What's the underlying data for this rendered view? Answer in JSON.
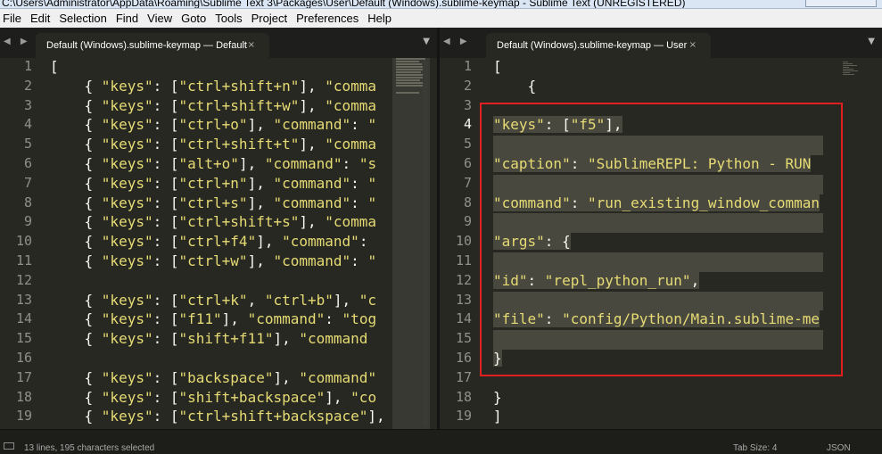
{
  "window": {
    "title": "C:\\Users\\Administrator\\AppData\\Roaming\\Sublime Text 3\\Packages\\User\\Default (Windows).sublime-keymap - Sublime Text (UNREGISTERED)"
  },
  "menu": [
    "File",
    "Edit",
    "Selection",
    "Find",
    "View",
    "Goto",
    "Tools",
    "Project",
    "Preferences",
    "Help"
  ],
  "tabs": {
    "left": {
      "label": "Default (Windows).sublime-keymap — Default",
      "close": "×"
    },
    "right": {
      "label": "Default (Windows).sublime-keymap — User",
      "close": "×"
    },
    "nav": "◀ ▶",
    "dropdown": "▼"
  },
  "left_pane": {
    "lines": [
      {
        "n": "1",
        "t": "["
      },
      {
        "n": "2",
        "t": "    { \"keys\": [\"ctrl+shift+n\"], \"comma"
      },
      {
        "n": "3",
        "t": "    { \"keys\": [\"ctrl+shift+w\"], \"comma"
      },
      {
        "n": "4",
        "t": "    { \"keys\": [\"ctrl+o\"], \"command\": \""
      },
      {
        "n": "5",
        "t": "    { \"keys\": [\"ctrl+shift+t\"], \"comma"
      },
      {
        "n": "6",
        "t": "    { \"keys\": [\"alt+o\"], \"command\": \"s"
      },
      {
        "n": "7",
        "t": "    { \"keys\": [\"ctrl+n\"], \"command\": \""
      },
      {
        "n": "8",
        "t": "    { \"keys\": [\"ctrl+s\"], \"command\": \""
      },
      {
        "n": "9",
        "t": "    { \"keys\": [\"ctrl+shift+s\"], \"comma"
      },
      {
        "n": "10",
        "t": "    { \"keys\": [\"ctrl+f4\"], \"command\":"
      },
      {
        "n": "11",
        "t": "    { \"keys\": [\"ctrl+w\"], \"command\": \""
      },
      {
        "n": "12",
        "t": ""
      },
      {
        "n": "13",
        "t": "    { \"keys\": [\"ctrl+k\", \"ctrl+b\"], \"c"
      },
      {
        "n": "14",
        "t": "    { \"keys\": [\"f11\"], \"command\": \"tog"
      },
      {
        "n": "15",
        "t": "    { \"keys\": [\"shift+f11\"], \"command"
      },
      {
        "n": "16",
        "t": ""
      },
      {
        "n": "17",
        "t": "    { \"keys\": [\"backspace\"], \"command\""
      },
      {
        "n": "18",
        "t": "    { \"keys\": [\"shift+backspace\"], \"co"
      },
      {
        "n": "19",
        "t": "    { \"keys\": [\"ctrl+shift+backspace\"],"
      }
    ]
  },
  "right_pane": {
    "lines": [
      {
        "n": "1",
        "t": "["
      },
      {
        "n": "2",
        "t": "    {"
      },
      {
        "n": "3",
        "t": ""
      },
      {
        "n": "4",
        "t": "\"keys\": [\"f5\"],"
      },
      {
        "n": "5",
        "t": ""
      },
      {
        "n": "6",
        "t": "\"caption\": \"SublimeREPL: Python - RUN"
      },
      {
        "n": "7",
        "t": ""
      },
      {
        "n": "8",
        "t": "\"command\": \"run_existing_window_comman"
      },
      {
        "n": "9",
        "t": ""
      },
      {
        "n": "10",
        "t": "\"args\": {"
      },
      {
        "n": "11",
        "t": ""
      },
      {
        "n": "12",
        "t": "\"id\": \"repl_python_run\","
      },
      {
        "n": "13",
        "t": ""
      },
      {
        "n": "14",
        "t": "\"file\": \"config/Python/Main.sublime-me"
      },
      {
        "n": "15",
        "t": ""
      },
      {
        "n": "16",
        "t": "}"
      },
      {
        "n": "17",
        "t": ""
      },
      {
        "n": "18",
        "t": "}"
      },
      {
        "n": "19",
        "t": "]"
      }
    ]
  },
  "status": {
    "selection": "13 lines, 195 characters selected",
    "tab_size": "Tab Size: 4",
    "syntax": "JSON"
  },
  "colors": {
    "background": "#272822",
    "string": "#e6db74",
    "text": "#f8f8f2",
    "line_number": "#8f908a",
    "selection": "#49483e",
    "highlight_border": "#e02020"
  }
}
